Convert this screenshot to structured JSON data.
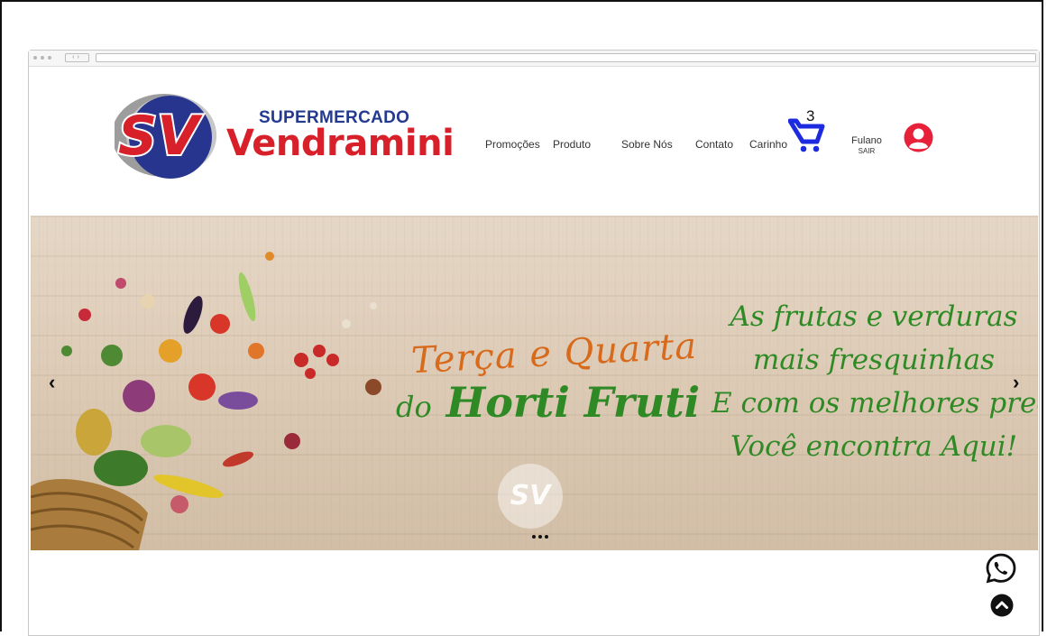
{
  "logo": {
    "top_text": "SUPERMERCADO",
    "main_text": "Vendramini",
    "mark_text": "SV"
  },
  "nav": {
    "items": [
      "Promoções",
      "Produto",
      "Sobre Nós",
      "Contato",
      "Carinho"
    ]
  },
  "cart": {
    "count": "3"
  },
  "user": {
    "name": "Fulano",
    "logout": "SAIR"
  },
  "banner": {
    "line1": "Terça e Quarta",
    "line2_prefix": "do",
    "line2_main": "Horti Fruti",
    "right_lines": [
      "As frutas e verduras",
      "mais fresquinhas",
      "E com os melhores preços",
      "Você encontra Aqui!"
    ],
    "watermark": "SV",
    "prev_arrow": "‹",
    "next_arrow": "›"
  },
  "colors": {
    "brand_blue": "#233a8f",
    "brand_red": "#d7202a",
    "cart_blue": "#1d2be0",
    "avatar_red": "#e8213a",
    "banner_green": "#2f8a26",
    "banner_orange": "#d86a1c"
  },
  "icons": {
    "cart": "cart-icon",
    "avatar": "user-avatar-icon",
    "whatsapp": "whatsapp-icon",
    "back_to_top": "chevron-up-icon"
  }
}
